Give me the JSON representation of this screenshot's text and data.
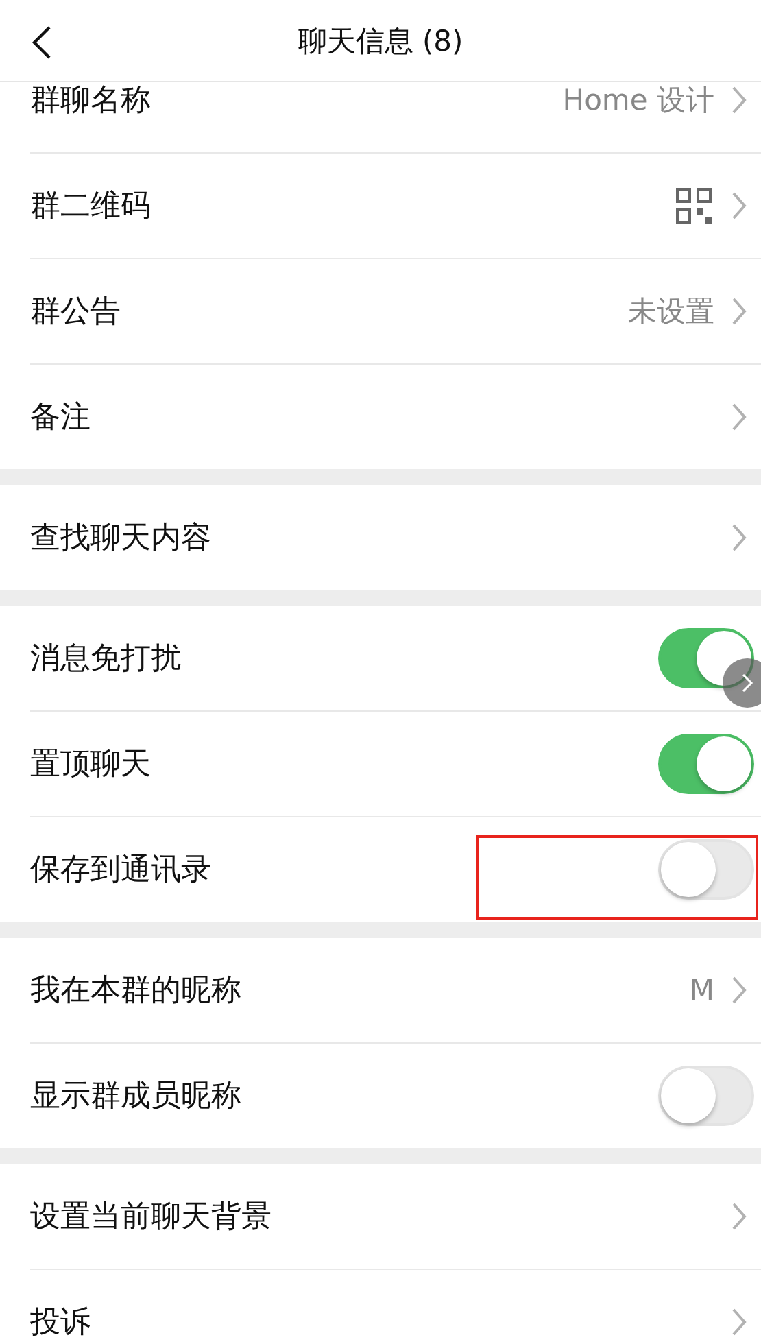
{
  "header": {
    "title": "聊天信息 (8)"
  },
  "groups": [
    {
      "items": [
        {
          "kind": "nav",
          "label": "群聊名称",
          "value": "Home 设计"
        },
        {
          "kind": "qr",
          "label": "群二维码"
        },
        {
          "kind": "nav",
          "label": "群公告",
          "value": "未设置"
        },
        {
          "kind": "nav",
          "label": "备注"
        }
      ]
    },
    {
      "items": [
        {
          "kind": "nav",
          "label": "查找聊天内容"
        }
      ]
    },
    {
      "items": [
        {
          "kind": "toggle",
          "label": "消息免打扰",
          "on": true,
          "highlighted": false
        },
        {
          "kind": "toggle",
          "label": "置顶聊天",
          "on": true,
          "highlighted": false
        },
        {
          "kind": "toggle",
          "label": "保存到通讯录",
          "on": false,
          "highlighted": true
        }
      ]
    },
    {
      "items": [
        {
          "kind": "nav",
          "label": "我在本群的昵称",
          "value": "M"
        },
        {
          "kind": "toggle",
          "label": "显示群成员昵称",
          "on": false,
          "highlighted": false
        }
      ]
    },
    {
      "items": [
        {
          "kind": "nav",
          "label": "设置当前聊天背景"
        },
        {
          "kind": "nav",
          "label": "投诉"
        }
      ]
    }
  ]
}
